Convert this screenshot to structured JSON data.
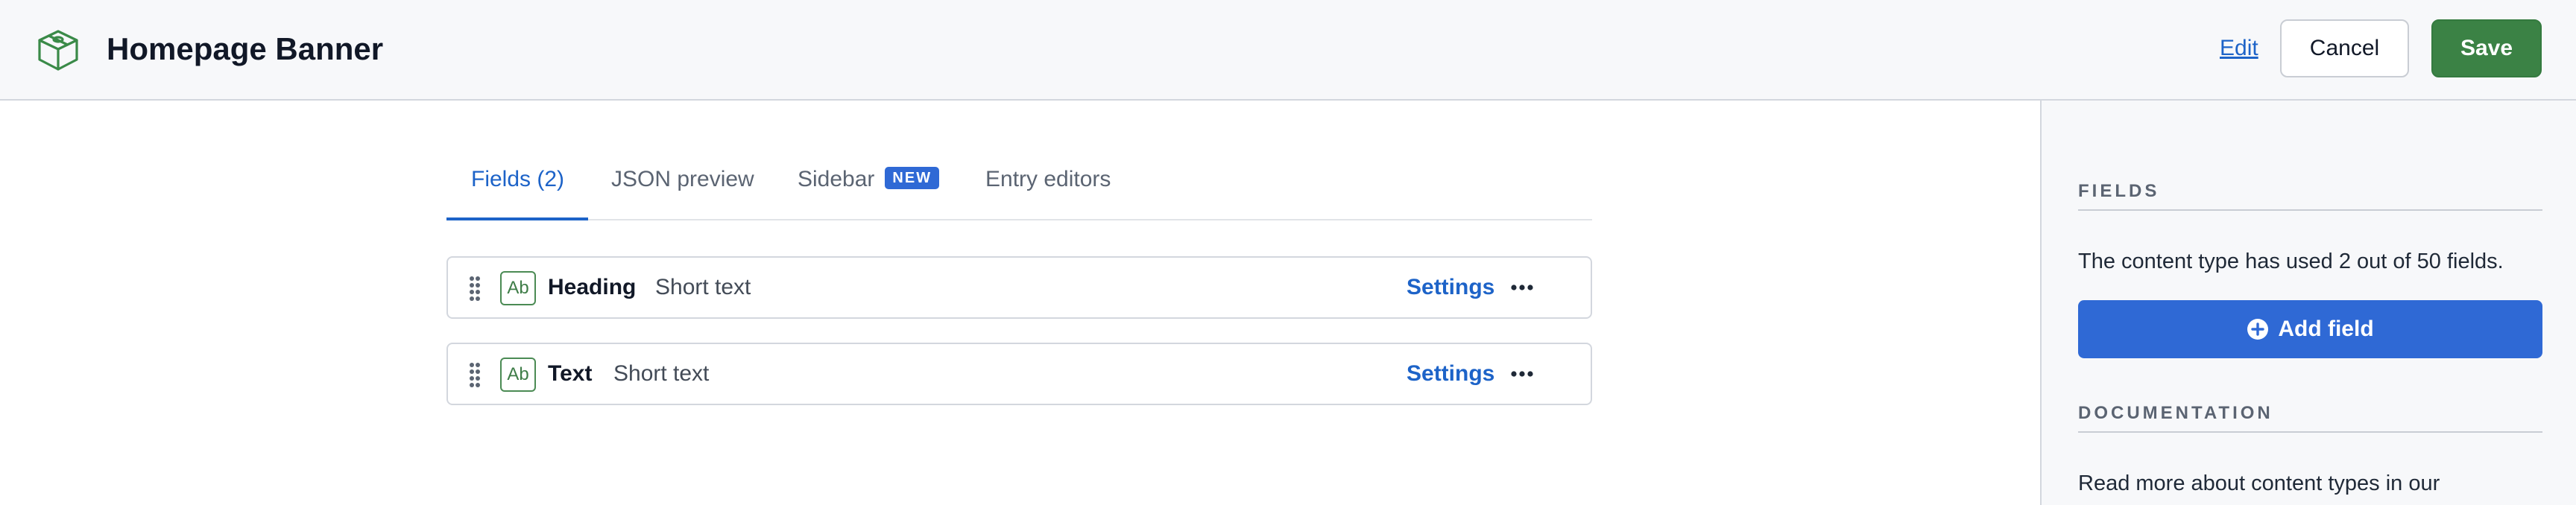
{
  "header": {
    "title": "Homepage Banner",
    "edit_label": "Edit",
    "cancel_label": "Cancel",
    "save_label": "Save",
    "logo_icon": "content-type-box-icon"
  },
  "tabs": [
    {
      "label": "Fields (2)",
      "active": true
    },
    {
      "label": "JSON preview",
      "active": false
    },
    {
      "label": "Sidebar",
      "badge": "NEW",
      "active": false
    },
    {
      "label": "Entry editors",
      "active": false
    }
  ],
  "fields": [
    {
      "icon_text": "Ab",
      "name": "Heading",
      "type": "Short text",
      "settings_label": "Settings"
    },
    {
      "icon_text": "Ab",
      "name": "Text",
      "type": "Short text",
      "settings_label": "Settings"
    }
  ],
  "sidebar": {
    "fields_heading": "FIELDS",
    "fields_usage_text": "The content type has used 2 out of 50 fields.",
    "add_field_label": "Add field",
    "documentation_heading": "DOCUMENTATION",
    "documentation_text": "Read more about content types in our"
  },
  "colors": {
    "accent_blue": "#2f69d5",
    "link_blue": "#1d63c8",
    "save_green": "#3b8245",
    "panel_bg": "#f7f8fa"
  }
}
